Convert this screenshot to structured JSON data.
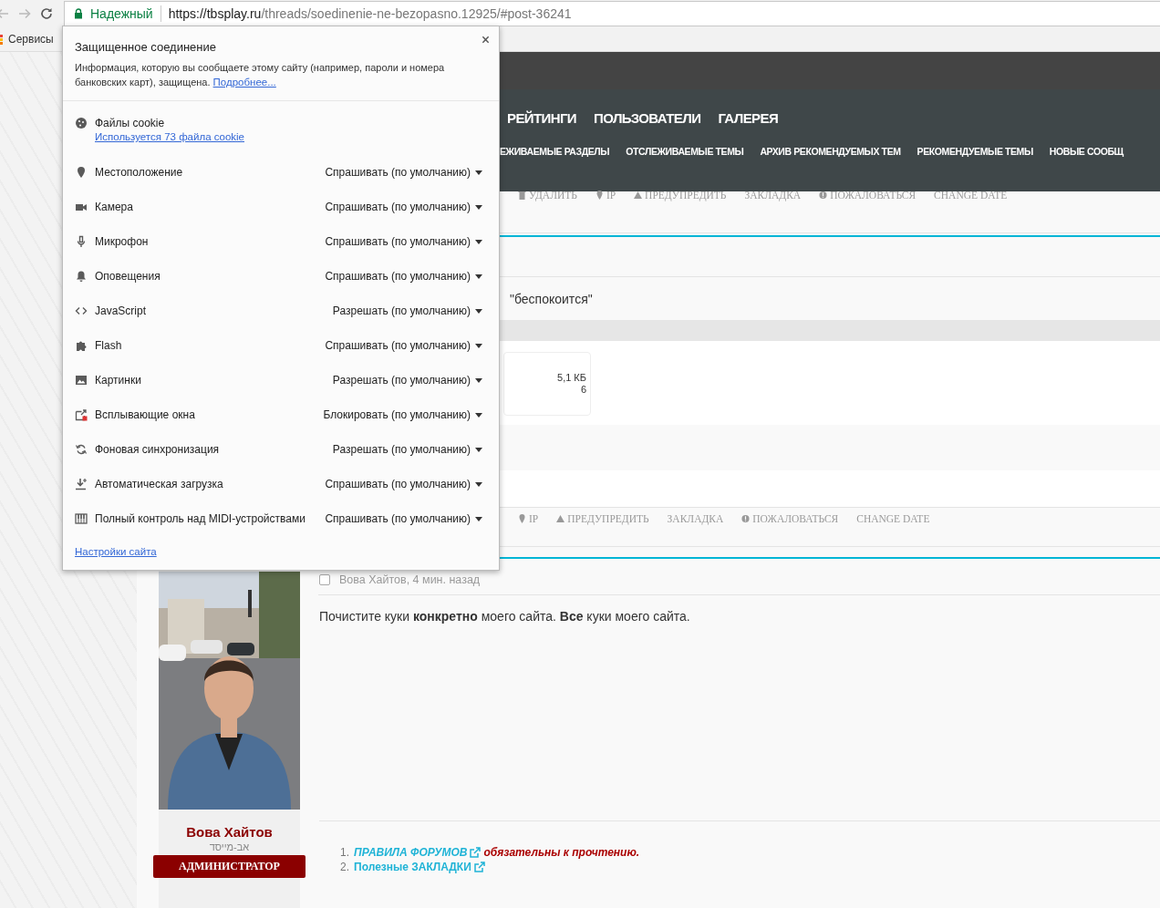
{
  "browser": {
    "security_label": "Надежный",
    "url_host": "https://tbsplay.ru",
    "url_path": "/threads/soedinenie-ne-bezopasno.12925/#post-36241",
    "bookmarks": [
      "Сервисы"
    ]
  },
  "site_info_popup": {
    "title": "Защищенное соединение",
    "description": "Информация, которую вы сообщаете этому сайту (например, пароли и номера банковских карт), защищена.",
    "details_link": "Подробнее...",
    "cookies": {
      "label": "Файлы cookie",
      "link": "Используется 73 файла cookie"
    },
    "permissions": [
      {
        "kind": "location",
        "label": "Местоположение",
        "value": "Спрашивать (по умолчанию)"
      },
      {
        "kind": "camera",
        "label": "Камера",
        "value": "Спрашивать (по умолчанию)"
      },
      {
        "kind": "microphone",
        "label": "Микрофон",
        "value": "Спрашивать (по умолчанию)"
      },
      {
        "kind": "notifications",
        "label": "Оповещения",
        "value": "Спрашивать (по умолчанию)"
      },
      {
        "kind": "javascript",
        "label": "JavaScript",
        "value": "Разрешать (по умолчанию)"
      },
      {
        "kind": "flash",
        "label": "Flash",
        "value": "Спрашивать (по умолчанию)"
      },
      {
        "kind": "images",
        "label": "Картинки",
        "value": "Разрешать (по умолчанию)"
      },
      {
        "kind": "popups",
        "label": "Всплывающие окна",
        "value": "Блокировать (по умолчанию)"
      },
      {
        "kind": "sync",
        "label": "Фоновая синхронизация",
        "value": "Разрешать (по умолчанию)"
      },
      {
        "kind": "downloads",
        "label": "Автоматическая загрузка",
        "value": "Спрашивать (по умолчанию)"
      },
      {
        "kind": "midi",
        "label": "Полный контроль над MIDI-устройствами",
        "value": "Спрашивать (по умолчанию)"
      }
    ],
    "settings_link": "Настройки сайта"
  },
  "page": {
    "main_nav": [
      "РЕЙТИНГИ",
      "ПОЛЬЗОВАТЕЛИ",
      "ГАЛЕРЕЯ"
    ],
    "sub_nav": [
      "ЕЖИВАЕМЫЕ РАЗДЕЛЫ",
      "ОТСЛЕЖИВАЕМЫЕ ТЕМЫ",
      "АРХИВ РЕКОМЕНДУЕМЫХ ТЕМ",
      "РЕКОМЕНДУЕМЫЕ ТЕМЫ",
      "НОВЫЕ СООБЩ"
    ],
    "post_actions_upper": [
      {
        "kind": "delete",
        "label": "УДАЛИТЬ"
      },
      {
        "kind": "ip",
        "label": "IP"
      },
      {
        "kind": "warn",
        "label": "ПРЕДУПРЕДИТЬ"
      },
      {
        "kind": "bookmark",
        "label": "ЗАКЛАДКА"
      },
      {
        "kind": "report",
        "label": "ПОЖАЛОВАТЬСЯ"
      },
      {
        "kind": "date",
        "label": "CHANGE DATE"
      }
    ],
    "quote_fragment": "\"беспокоится\"",
    "attachment": {
      "size": "5,1 КБ",
      "views": "6"
    },
    "post_actions_lower": [
      {
        "kind": "ip",
        "label": "IP"
      },
      {
        "kind": "warn",
        "label": "ПРЕДУПРЕДИТЬ"
      },
      {
        "kind": "bookmark",
        "label": "ЗАКЛАДКА"
      },
      {
        "kind": "report",
        "label": "ПОЖАЛОВАТЬСЯ"
      },
      {
        "kind": "date",
        "label": "CHANGE DATE"
      }
    ],
    "post": {
      "author": {
        "name": "Вова Хайтов",
        "title": "אב-מייסד",
        "role": "АДМИНИСТРАТОР"
      },
      "checked": false,
      "meta": "Вова Хайтов, 4 мин. назад",
      "body": "Почистите куки **конкретно** моего сайта. **Все** куки моего сайта.",
      "signature": [
        {
          "number": "1.",
          "link": "ПРАВИЛА ФОРУМОВ",
          "note": "обязательны к прочтению.",
          "italic": true
        },
        {
          "number": "2.",
          "link": "Полезные ЗАКЛАДКИ",
          "italic": false
        }
      ]
    }
  }
}
